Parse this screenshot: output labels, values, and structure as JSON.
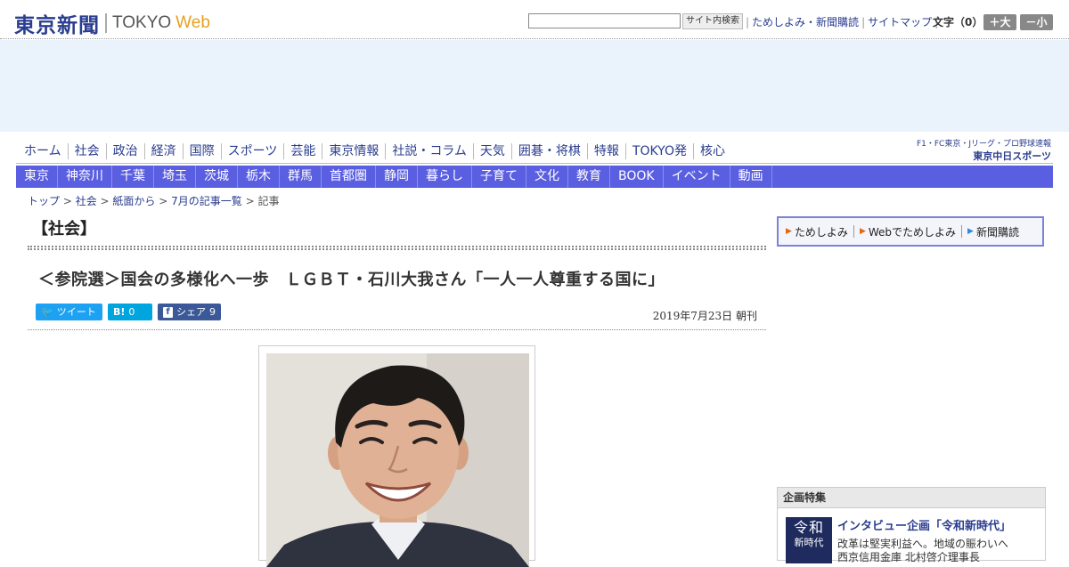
{
  "header": {
    "logo_jp": "東京新聞",
    "logo_en": "TOKYO",
    "logo_web": "Web",
    "search_button": "サイト内検索",
    "links": [
      "ためしよみ・新聞購読",
      "サイトマップ"
    ],
    "font_size_label": "文字（0）",
    "font_larger": "＋大",
    "font_smaller": "－小"
  },
  "nav_primary": [
    "ホーム",
    "社会",
    "政治",
    "経済",
    "国際",
    "スポーツ",
    "芸能",
    "東京情報",
    "社説・コラム",
    "天気",
    "囲碁・将棋",
    "特報",
    "TOKYO発",
    "核心"
  ],
  "chunichi": {
    "top": "F1・FC東京・Jリーグ・プロ野球速報",
    "bottom": "東京中日スポーツ"
  },
  "nav_regional": [
    "東京",
    "神奈川",
    "千葉",
    "埼玉",
    "茨城",
    "栃木",
    "群馬",
    "首都圏",
    "静岡",
    "暮らし",
    "子育て",
    "文化",
    "教育",
    "BOOK",
    "イベント",
    "動画"
  ],
  "breadcrumb": {
    "items": [
      "トップ",
      "社会",
      "紙面から",
      "7月の記事一覧"
    ],
    "current": "記事",
    "separator": " > "
  },
  "section": "【社会】",
  "article": {
    "title": "＜参院選＞国会の多様化へ一歩　ＬＧＢＴ・石川大我さん「一人一人尊重する国に」",
    "date": "2019年7月23日 朝刊"
  },
  "share": {
    "tweet": "ツイート",
    "hatena_count": "0",
    "facebook": "シェア",
    "facebook_count": "9"
  },
  "promo": [
    "ためしよみ",
    "Webでためしよみ",
    "新聞購読"
  ],
  "feature": {
    "heading": "企画特集",
    "img_line1": "令和",
    "img_line2": "新時代",
    "title": "インタビュー企画「令和新時代」",
    "text_line1": "改革は堅実利益へ。地域の賑わいへ",
    "text_line2": "西京信用金庫 北村啓介理事長"
  },
  "colors": {
    "brand_navy": "#2a3d8f",
    "nav_blue": "#5a5ee0",
    "twitter": "#1da1f2",
    "hatena": "#00a4de",
    "facebook": "#3b5998",
    "ad_band": "#eaf2fb"
  }
}
